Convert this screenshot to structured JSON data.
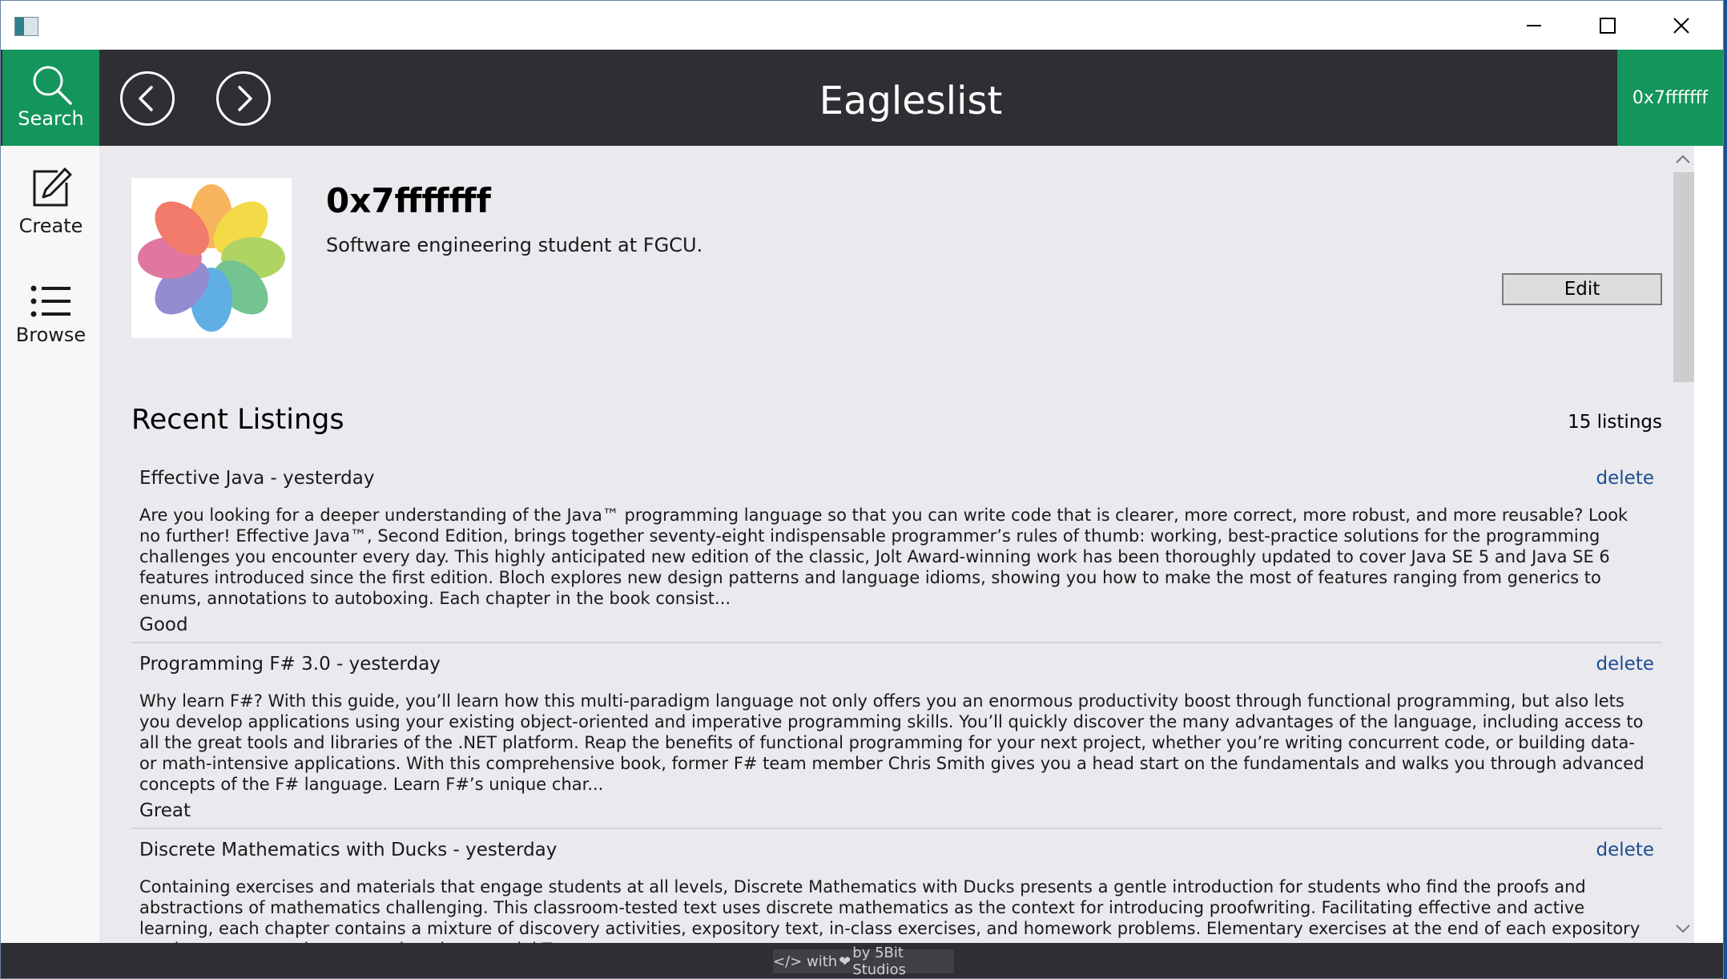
{
  "window": {
    "controls": [
      "minimize",
      "maximize",
      "close"
    ]
  },
  "nav": {
    "search_label": "Search",
    "app_title": "Eagleslist",
    "user_badge": "0x7fffffff",
    "back_icon": "chevron-left-circle-icon",
    "forward_icon": "chevron-right-circle-icon"
  },
  "sidebar": {
    "items": [
      {
        "label": "Create",
        "icon": "pencil-edit-icon"
      },
      {
        "label": "Browse",
        "icon": "list-icon"
      }
    ]
  },
  "profile": {
    "username": "0x7fffffff",
    "bio": "Software engineering student at FGCU.",
    "edit_label": "Edit",
    "avatar_icon": "photos-flower-icon"
  },
  "listings": {
    "heading": "Recent Listings",
    "count_text": "15 listings",
    "delete_label": "delete",
    "items": [
      {
        "title": "Effective Java - yesterday",
        "description": "Are you looking for a deeper understanding of the Java™ programming language so that you can write code that is clearer, more correct, more robust, and more reusable? Look no further! Effective Java™, Second Edition, brings together seventy-eight indispensable programmer’s rules of thumb: working, best-practice solutions for the programming challenges you encounter every day. This highly anticipated new edition of the classic, Jolt Award-winning work has been thoroughly updated to cover Java SE 5 and Java SE 6 features introduced since the first edition. Bloch explores new design patterns and language idioms, showing you how to make the most of features ranging from generics to enums, annotations to autoboxing. Each chapter in the book consist...",
        "condition": "Good"
      },
      {
        "title": "Programming F# 3.0 - yesterday",
        "description": "Why learn F#? With this guide, you’ll learn how this multi-paradigm language not only offers you an enormous productivity boost through functional programming, but also lets you develop applications using your existing object-oriented and imperative programming skills. You’ll quickly discover the many advantages of the language, including access to all the great tools and libraries of the .NET platform. Reap the benefits of functional programming for your next project, whether you’re writing concurrent code, or building data- or math-intensive applications. With this comprehensive book, former F# team member Chris Smith gives you a head start on the fundamentals and walks you through advanced concepts of the F# language. Learn F#’s unique char...",
        "condition": "Great"
      },
      {
        "title": "Discrete Mathematics with Ducks - yesterday",
        "description": "Containing exercises and materials that engage students at all levels, Discrete Mathematics with Ducks presents a gentle introduction for students who find the proofs and abstractions of mathematics challenging. This classroom-tested text uses discrete mathematics as the context for introducing proofwriting. Facilitating effective and active learning, each chapter contains a mixture of discovery activities, expository text, in-class exercises, and homework problems. Elementary exercises at the end of each expository section prompt students to review the material Try",
        "condition": ""
      }
    ]
  },
  "footer": {
    "code_glyph": "</>",
    "with_text": "with",
    "by_text": "by 5Bit Studios"
  },
  "colors": {
    "accent_green": "#13955c",
    "nav_dark": "#2d2f33",
    "content_bg": "#e9e9ee",
    "link_blue": "#1c4e91"
  }
}
